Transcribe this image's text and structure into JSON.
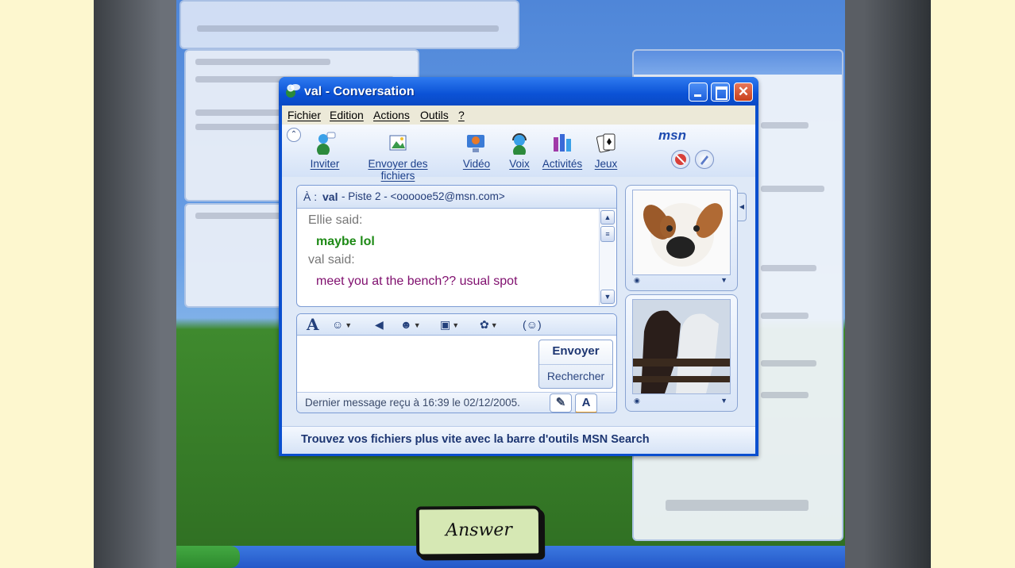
{
  "window": {
    "title": "val - Conversation"
  },
  "menu": [
    "Fichier",
    "Edition",
    "Actions",
    "Outils",
    "?"
  ],
  "toolbar": {
    "items": [
      "Inviter",
      "Envoyer des fichiers",
      "Vidéo",
      "Voix",
      "Activités",
      "Jeux"
    ],
    "brand": "msn"
  },
  "recipient": {
    "label": "À :",
    "name": "val",
    "detail": "- Piste 2 - <oooooe52@msn.com>"
  },
  "messages": [
    {
      "sender": "Ellie said:",
      "text": "maybe lol",
      "color": "#1e8a16"
    },
    {
      "sender": "val said:",
      "text": "meet you at the bench?? usual spot",
      "color": "#80106f"
    }
  ],
  "compose": {
    "send_label": "Envoyer",
    "search_label": "Rechercher",
    "status": "Dernier message reçu à 16:39 le 02/12/2005."
  },
  "banner": "Trouvez vos fichiers plus vite avec la barre d'outils MSN Search",
  "game": {
    "answer_label": "Answer"
  },
  "colors": {
    "titlebar": "#0b52d6",
    "answer_button": "#d6e8b4",
    "page_background": "#fdf7cf"
  }
}
